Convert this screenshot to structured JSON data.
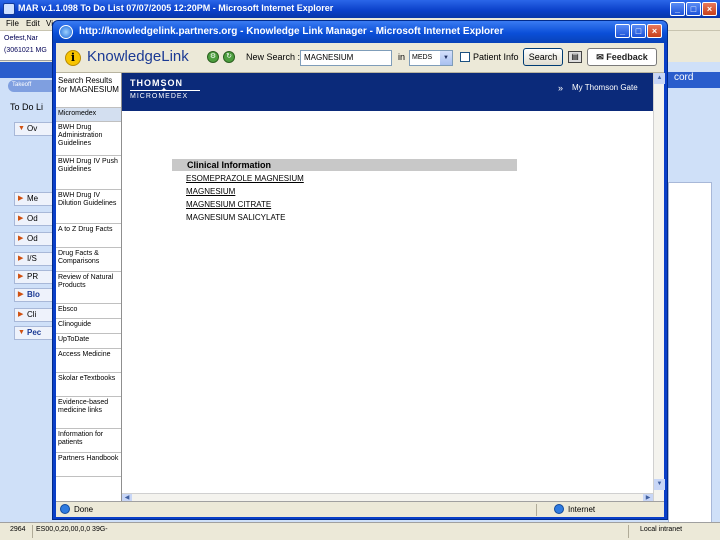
{
  "outer_window": {
    "title": "MAR v.1.1.098   To Do List   07/07/2005 12:20PM - Microsoft Internet Explorer",
    "menu": [
      "File",
      "Edit",
      "View"
    ],
    "patient_lines": [
      "Oefest,Nar",
      "(3061021 MG"
    ],
    "tab_label": "Takeoff",
    "todo_label": "To Do Li",
    "accordion": [
      {
        "label": "Ov",
        "bold": false
      },
      {
        "label": "Me",
        "bold": false
      },
      {
        "label": "Od",
        "bold": false
      },
      {
        "label": "Od",
        "bold": false
      },
      {
        "label": "I/S",
        "bold": false
      },
      {
        "label": "PR",
        "bold": false
      },
      {
        "label": "Blo",
        "bold": true
      },
      {
        "label": "Cli",
        "bold": false
      },
      {
        "label": "Pec",
        "bold": true
      }
    ],
    "right_label": "cord",
    "status": {
      "left": "2964",
      "middle": "ES00,0,20,00,0,0 39G-",
      "right": "Local intranet"
    }
  },
  "popup": {
    "title": "http://knowledgelink.partners.org - Knowledge Link Manager - Microsoft Internet Explorer",
    "toolbar": {
      "info_glyph": "i",
      "brand": "KnowledgeLink",
      "new_search_label": "New Search :",
      "search_value": "MAGNESIUM",
      "in_label": "in",
      "db_value": "MEDS",
      "patient_label": "Patient Info",
      "search_button": "Search",
      "feedback_button": "Feedback"
    },
    "nav": {
      "header": "Search Results for MAGNESIUM",
      "items": [
        {
          "label": "Micromedex",
          "selected": true
        },
        {
          "label": "BWH Drug Administration Guidelines",
          "selected": false
        },
        {
          "label": "BWH Drug IV Push Guidelines",
          "selected": false
        },
        {
          "label": "BWH Drug IV Dilution Guidelines",
          "selected": false
        },
        {
          "label": "A to Z Drug Facts",
          "selected": false
        },
        {
          "label": "Drug Facts & Comparisons",
          "selected": false
        },
        {
          "label": "Review of Natural Products",
          "selected": false
        },
        {
          "label": "Ebsco",
          "selected": false
        },
        {
          "label": "Clinoguide",
          "selected": false
        },
        {
          "label": "UpToDate",
          "selected": false
        },
        {
          "label": "Access Medicine",
          "selected": false
        },
        {
          "label": "Skolar eTextbooks",
          "selected": false
        },
        {
          "label": "Evidence-based medicine links",
          "selected": false
        },
        {
          "label": "Information for patients",
          "selected": false
        },
        {
          "label": "Partners Handbook",
          "selected": false
        }
      ]
    },
    "banner": {
      "thomson": "THOMSON",
      "micromedex": "MICROMEDEX",
      "my_thomson": "My Thomson Gate"
    },
    "content": {
      "section_header": "Clinical Information",
      "results": [
        {
          "label": "ESOMEPRAZOLE MAGNESIUM",
          "link": true
        },
        {
          "label": "MAGNESIUM",
          "link": true
        },
        {
          "label": "MAGNESIUM CITRATE",
          "link": true
        },
        {
          "label": "MAGNESIUM SALICYLATE",
          "link": false
        }
      ]
    },
    "status": {
      "left": "Done",
      "zone": "Internet"
    }
  }
}
